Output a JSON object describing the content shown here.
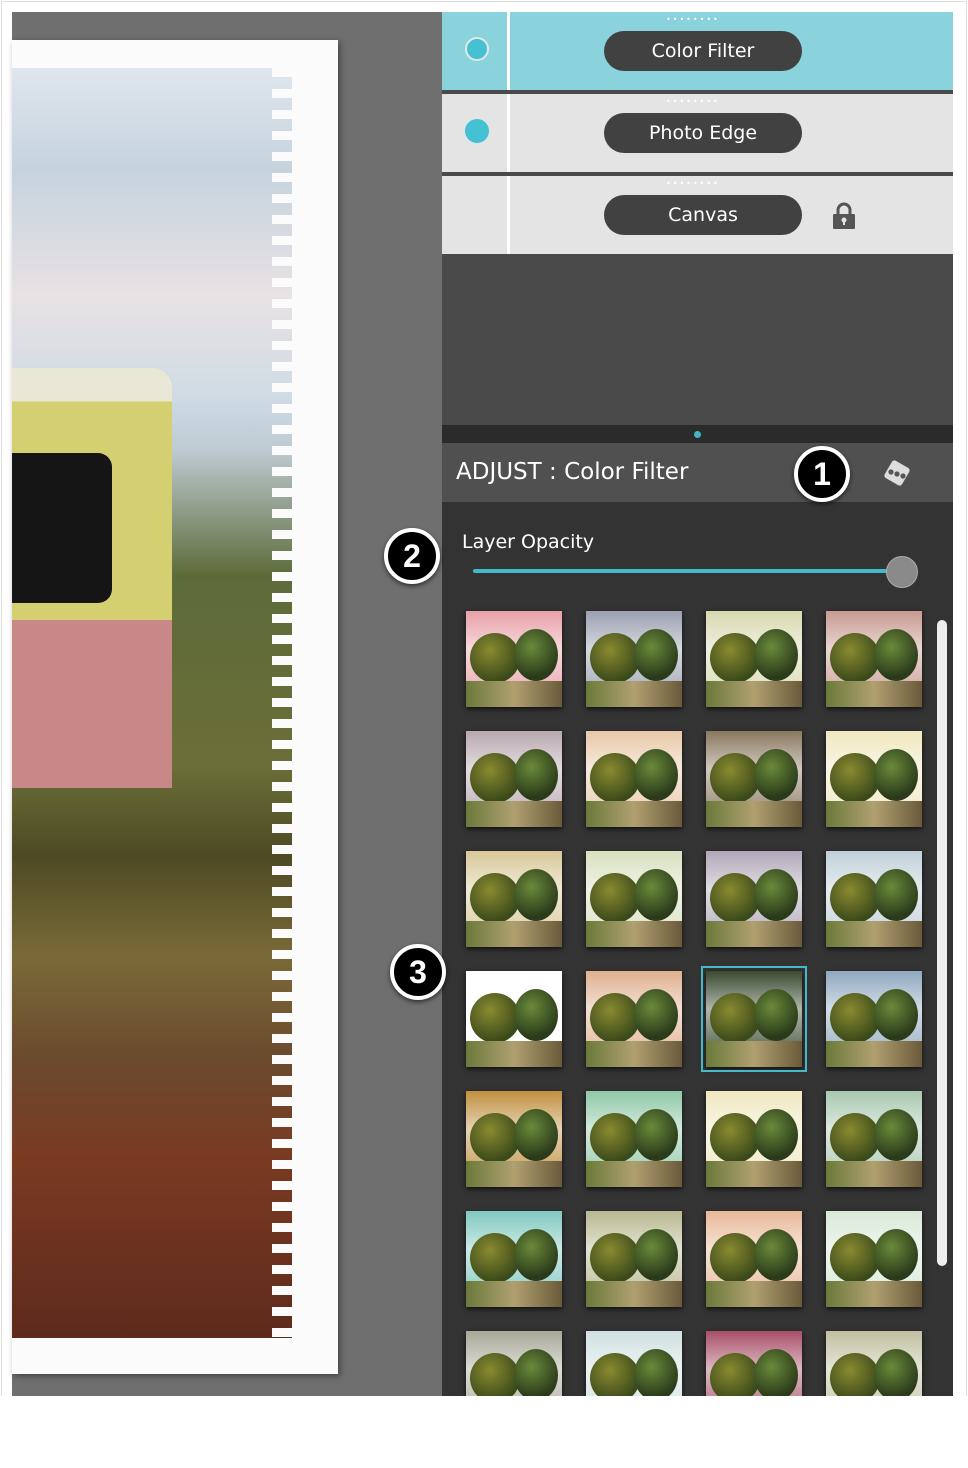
{
  "layers": [
    {
      "name": "Color Filter",
      "selected": true,
      "visible": true,
      "locked": false
    },
    {
      "name": "Photo Edge",
      "selected": false,
      "visible": true,
      "locked": false
    },
    {
      "name": "Canvas",
      "selected": false,
      "visible": false,
      "locked": true
    }
  ],
  "adjust": {
    "title": "ADJUST : Color Filter",
    "randomize_icon": "dice-icon"
  },
  "opacity": {
    "label": "Layer Opacity",
    "value_percent": 100
  },
  "filters": {
    "selected_index": 14,
    "tints": [
      "#e8a0a8",
      "#9aa0b0",
      "#d8d8b0",
      "#c89a90",
      "#b8a8b0",
      "#e8c8a8",
      "#8a7860",
      "#f0e8c0",
      "#d8c898",
      "#d8e0c0",
      "#b0a8b8",
      "#c0d0d8",
      "#ffffff",
      "#e0b090",
      "#3a4a30",
      "#90a8c0",
      "#c09040",
      "#90c8a8",
      "#f0e8c0",
      "#a8c8b0",
      "#80c8c0",
      "#b8b890",
      "#e8b898",
      "#d8e8d8",
      "#a8a898",
      "#d0e0e0",
      "#a85068",
      "#c0c0a0"
    ]
  },
  "callouts": [
    "1",
    "2",
    "3"
  ],
  "colors": {
    "accent": "#45c1d4",
    "selected_layer": "#8ad3dc",
    "panel": "#333333"
  }
}
